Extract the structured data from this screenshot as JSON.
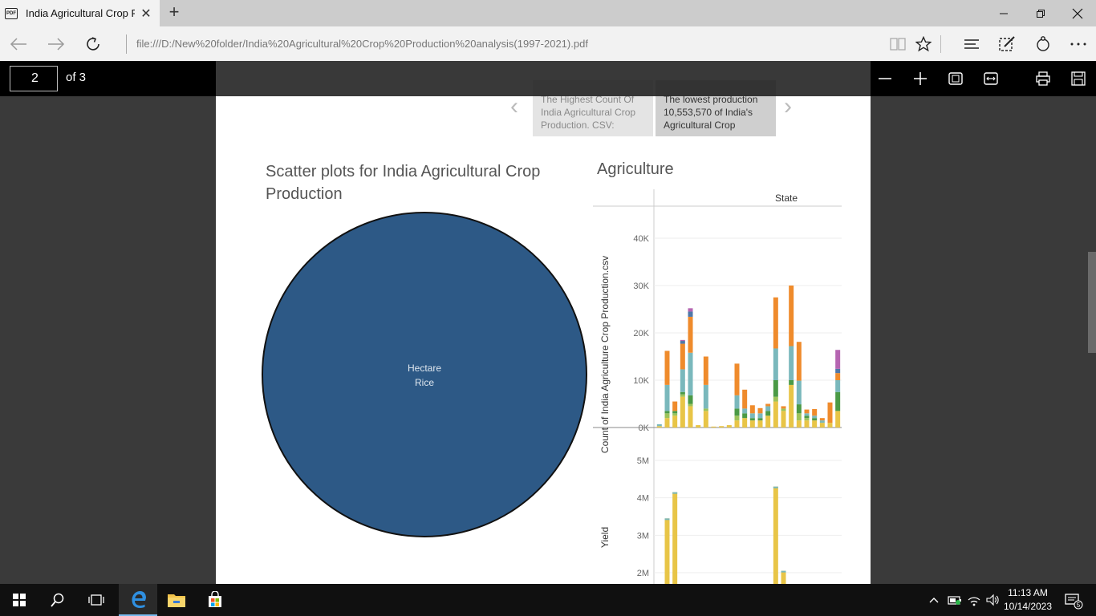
{
  "browser": {
    "tab_title": "India Agricultural Crop P",
    "tab_icon": "PDF",
    "url": "file:///D:/New%20folder/India%20Agricultural%20Crop%20Production%20analysis(1997-2021).pdf"
  },
  "pdf_toolbar": {
    "page_number": "2",
    "page_total": "of 3"
  },
  "story": {
    "tab1_text": "The Highest Count Of India Agricultural Crop Production. CSV:",
    "tab2_text": "The lowest production 10,553,570 of India's Agricultural Crop"
  },
  "scatter": {
    "title": "Scatter plots for India Agricultural Crop Production",
    "bubble_line1": "Hectare",
    "bubble_line2": "Rice",
    "bubble_color": "#2d5986"
  },
  "agri_chart": {
    "title": "Agriculture",
    "column_header": "State",
    "y1_label": "Count of India Agriculture Crop Production.csv",
    "y2_label": "Yield",
    "y1_ticks": [
      "0K",
      "10K",
      "20K",
      "30K",
      "40K"
    ],
    "y2_ticks": [
      "2M",
      "3M",
      "4M",
      "5M"
    ]
  },
  "chart_data": {
    "type": "bar",
    "title": "Agriculture",
    "xlabel": "State",
    "panels": [
      {
        "ylabel": "Count of India Agriculture Crop Production.csv",
        "ylim": [
          0,
          45000
        ],
        "stacked": true,
        "segment_colors": [
          "#e8c547",
          "#9cc35a",
          "#4b9a46",
          "#7ab8bc",
          "#ef8b2c",
          "#4f77a8",
          "#b565b1"
        ],
        "bars": [
          [
            300,
            0,
            0,
            400,
            0,
            0,
            0
          ],
          [
            2000,
            1000,
            500,
            5500,
            7200,
            0,
            0
          ],
          [
            2500,
            500,
            500,
            0,
            2000,
            0,
            0
          ],
          [
            6500,
            500,
            500,
            4800,
            5400,
            600,
            200
          ],
          [
            4500,
            500,
            1800,
            9000,
            7600,
            1100,
            700
          ],
          [
            500,
            0,
            0,
            0,
            0,
            0,
            0
          ],
          [
            3500,
            500,
            0,
            5000,
            6000,
            0,
            0
          ],
          [
            200,
            0,
            0,
            0,
            0,
            0,
            0
          ],
          [
            300,
            0,
            0,
            0,
            0,
            0,
            0
          ],
          [
            500,
            0,
            0,
            0,
            0,
            0,
            0
          ],
          [
            1500,
            1000,
            1500,
            2800,
            6700,
            0,
            0
          ],
          [
            2000,
            0,
            1000,
            1000,
            4000,
            0,
            0
          ],
          [
            1500,
            0,
            500,
            1000,
            1700,
            0,
            0
          ],
          [
            1500,
            0,
            500,
            1000,
            1100,
            0,
            0
          ],
          [
            2500,
            0,
            1000,
            1000,
            500,
            0,
            0
          ],
          [
            5500,
            1000,
            3500,
            6700,
            10800,
            0,
            0
          ],
          [
            3500,
            500,
            0,
            0,
            500,
            0,
            0
          ],
          [
            9000,
            0,
            1000,
            7200,
            12800,
            0,
            0
          ],
          [
            1500,
            1500,
            1900,
            5000,
            8200,
            0,
            0
          ],
          [
            1500,
            500,
            500,
            500,
            800,
            0,
            0
          ],
          [
            1500,
            0,
            500,
            500,
            1400,
            0,
            0
          ],
          [
            1000,
            0,
            0,
            500,
            500,
            0,
            0
          ],
          [
            1000,
            0,
            0,
            0,
            4300,
            0,
            0
          ],
          [
            3500,
            0,
            4000,
            2500,
            1500,
            900,
            4000
          ]
        ]
      },
      {
        "ylabel": "Yield",
        "ylim": [
          1600000,
          5500000
        ],
        "values": [
          0,
          3450000,
          4150000,
          0,
          0,
          0,
          0,
          0,
          0,
          0,
          0,
          0,
          0,
          0,
          0,
          4300000,
          2050000,
          0,
          0,
          0,
          0,
          0,
          0,
          0
        ]
      }
    ]
  }
}
